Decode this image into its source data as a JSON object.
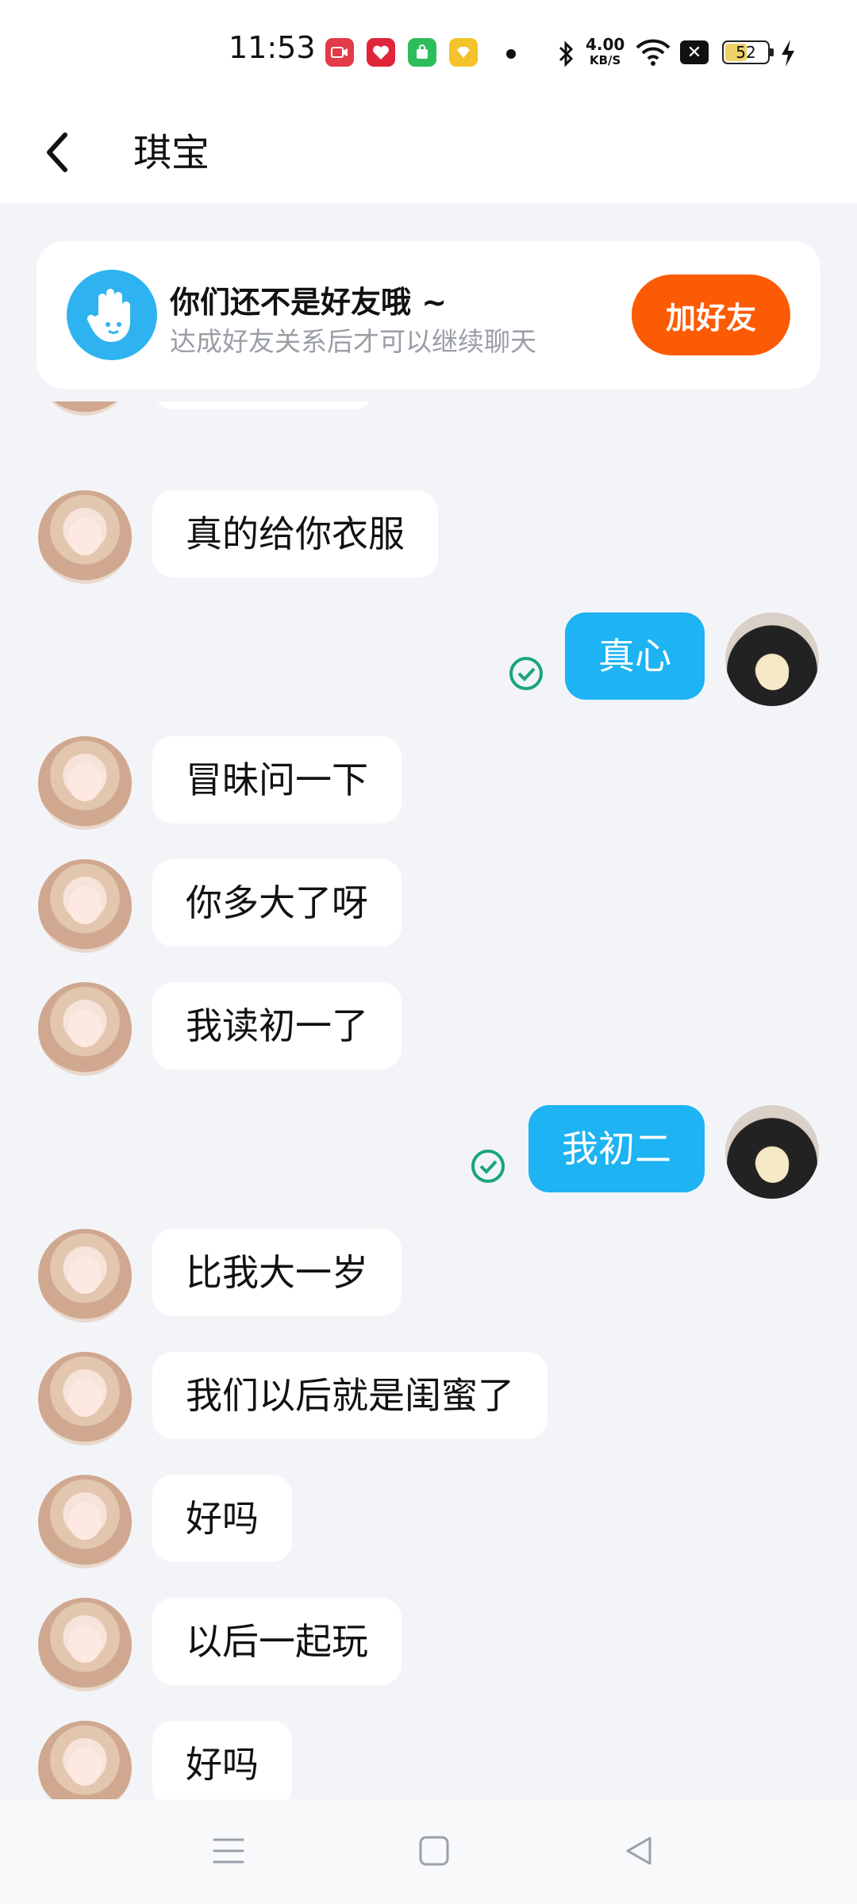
{
  "status_bar": {
    "time": "11:53",
    "net_speed_value": "4.00",
    "net_speed_unit": "KB/S",
    "battery_level": "52",
    "app_icon_colors": [
      "#e23b4a",
      "#e0243a",
      "#2dbd5a",
      "#f4c22b"
    ]
  },
  "header": {
    "title": "琪宝",
    "back_icon": "chevron-left-icon"
  },
  "banner": {
    "title": "你们还不是好友哦 ~",
    "subtitle": "达成好友关系后才可以继续聊天",
    "button_label": "加好友",
    "icon": "waving-hand-icon"
  },
  "messages": [
    {
      "sender": "them",
      "text": "真的给你衣服"
    },
    {
      "sender": "me",
      "text": "真心",
      "read": true
    },
    {
      "sender": "them",
      "text": "冒昧问一下"
    },
    {
      "sender": "them",
      "text": "你多大了呀"
    },
    {
      "sender": "them",
      "text": "我读初一了"
    },
    {
      "sender": "me",
      "text": "我初二",
      "read": true
    },
    {
      "sender": "them",
      "text": "比我大一岁"
    },
    {
      "sender": "them",
      "text": "我们以后就是闺蜜了"
    },
    {
      "sender": "them",
      "text": "好吗"
    },
    {
      "sender": "them",
      "text": "以后一起玩"
    },
    {
      "sender": "them",
      "text": "好吗"
    }
  ],
  "colors": {
    "accent_blue": "#1eb3f2",
    "add_friend_orange": "#fc5b06",
    "read_check_green": "#1aa57a",
    "page_bg": "#f2f4f8"
  },
  "navbar": {
    "icons": [
      "menu-icon",
      "home-square-icon",
      "back-triangle-icon"
    ]
  }
}
